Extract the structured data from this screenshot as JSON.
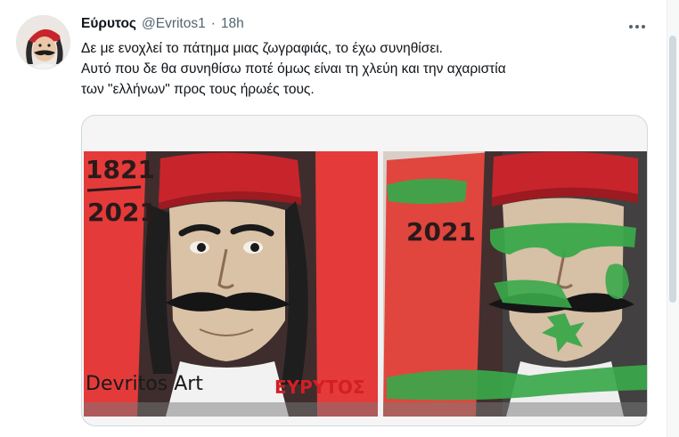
{
  "tweet": {
    "display_name": "Εύρυτος",
    "handle": "@Evritos1",
    "separator": "·",
    "timestamp": "18h",
    "text_lines": [
      "Δε με ενοχλεί το πάτημα μιας ζωγραφιάς, το έχω συνηθίσει.",
      "Αυτό που δε θα συνηθίσω ποτέ όμως είναι τη χλεύη και την αχαριστία",
      "των \"ελλήνων\" προς τους ήρωές τους."
    ],
    "more_icon": "more-horizontal-icon"
  },
  "media": {
    "left_panel_text": {
      "year_top": "1821",
      "year_bottom": "2021",
      "signature_left": "Devritos Art",
      "signature_right": "ΕΥΡΥΤΟΣ"
    },
    "right_panel_text": {
      "year": "2021"
    },
    "colors": {
      "red_background": "#e53a3a",
      "vandal_green": "#3aa84a",
      "fez_red": "#c8242c"
    }
  }
}
